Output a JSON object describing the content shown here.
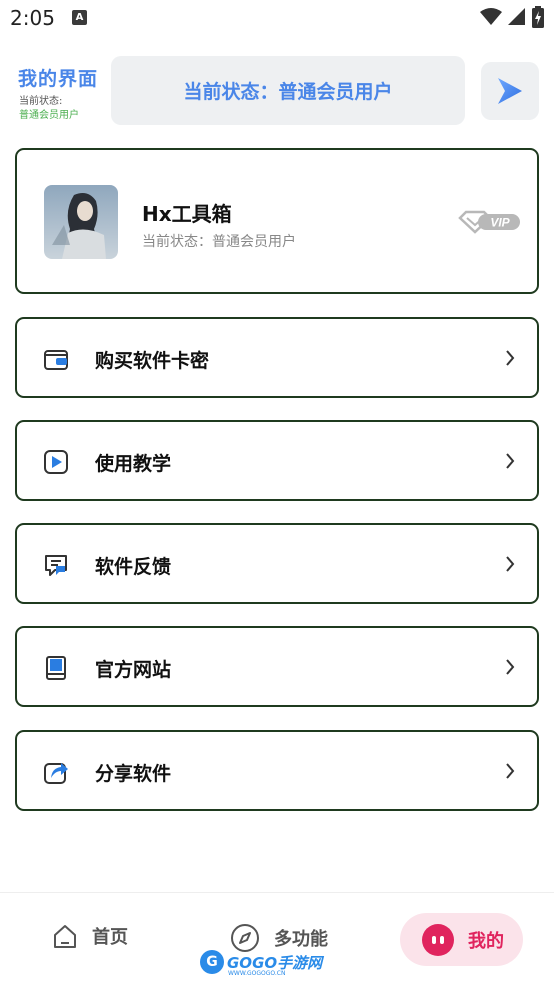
{
  "status_bar": {
    "time": "2:05",
    "notif_glyph": "A"
  },
  "header": {
    "title": "我的界面",
    "subtitle_line1": "当前状态:",
    "subtitle_line2": "普通会员用户",
    "status_box": "当前状态：普通会员用户",
    "play_icon": "play-icon"
  },
  "profile": {
    "name": "Hx工具箱",
    "status": "当前状态：普通会员用户",
    "badge": "VIP"
  },
  "menu": [
    {
      "label": "购买软件卡密",
      "icon": "wallet-icon"
    },
    {
      "label": "使用教学",
      "icon": "video-play-icon"
    },
    {
      "label": "软件反馈",
      "icon": "message-icon"
    },
    {
      "label": "官方网站",
      "icon": "book-icon"
    },
    {
      "label": "分享软件",
      "icon": "share-icon"
    }
  ],
  "nav": {
    "home": "首页",
    "multi": "多功能",
    "mine": "我的"
  },
  "watermark": {
    "circle": "G",
    "text": "GOGO手游网",
    "url": "WWW.GOGOGO.CN"
  },
  "colors": {
    "accent": "#4a86e8",
    "mine": "#e0245e",
    "border": "#1f3a1f",
    "green": "#4caf50"
  }
}
